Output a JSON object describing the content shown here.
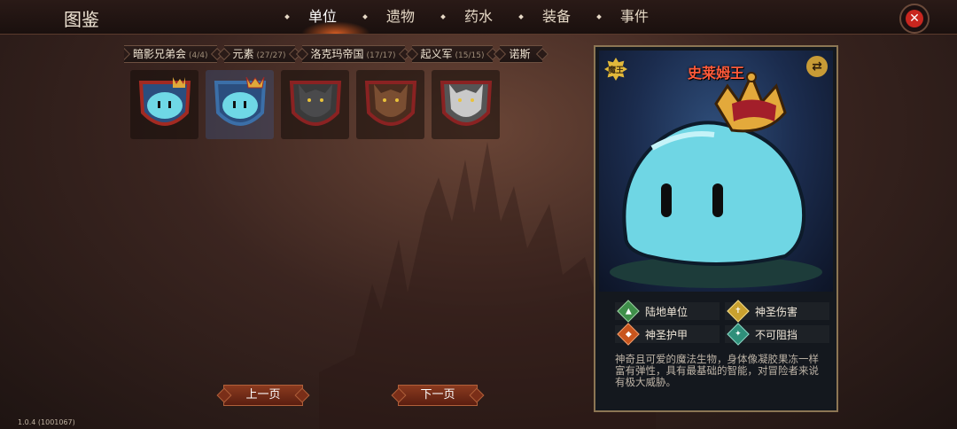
{
  "header": {
    "title": "图鉴",
    "tabs": [
      {
        "label": "单位",
        "active": true
      },
      {
        "label": "遗物",
        "active": false
      },
      {
        "label": "药水",
        "active": false
      },
      {
        "label": "装备",
        "active": false
      },
      {
        "label": "事件",
        "active": false
      }
    ],
    "close_icon": "close-icon"
  },
  "factions": [
    {
      "name": "暗影兄弟会",
      "count": "(4/4)"
    },
    {
      "name": "元素",
      "count": "(27/27)"
    },
    {
      "name": "洛克玛帝国",
      "count": "(17/17)"
    },
    {
      "name": "起义军",
      "count": "(15/15)"
    },
    {
      "name": "诺斯",
      "count": ""
    }
  ],
  "units": [
    {
      "kind": "slime-king"
    },
    {
      "kind": "slime-king-selected"
    },
    {
      "kind": "werewolf-dark"
    },
    {
      "kind": "werewolf-brown"
    },
    {
      "kind": "werewolf-white"
    }
  ],
  "pager": {
    "prev": "上一页",
    "next": "下一页"
  },
  "version": "1.0.4 (1001067)",
  "detail": {
    "rank": "魔王",
    "name": "史莱姆王",
    "traits": [
      {
        "label": "陆地单位",
        "icon": "land-unit-icon",
        "color": "#3f8f4a"
      },
      {
        "label": "神圣伤害",
        "icon": "holy-damage-icon",
        "color": "#c9a12f"
      },
      {
        "label": "神圣护甲",
        "icon": "holy-armor-icon",
        "color": "#c8551d"
      },
      {
        "label": "不可阻挡",
        "icon": "unstoppable-icon",
        "color": "#2f8f7a"
      }
    ],
    "description": "神奇且可爱的魔法生物，身体像凝胶果冻一样富有弹性，具有最基础的智能，对冒险者来说有极大威胁。"
  },
  "colors": {
    "accent": "#ff5a3a",
    "frame": "#8c7654",
    "close": "#c8261f"
  }
}
